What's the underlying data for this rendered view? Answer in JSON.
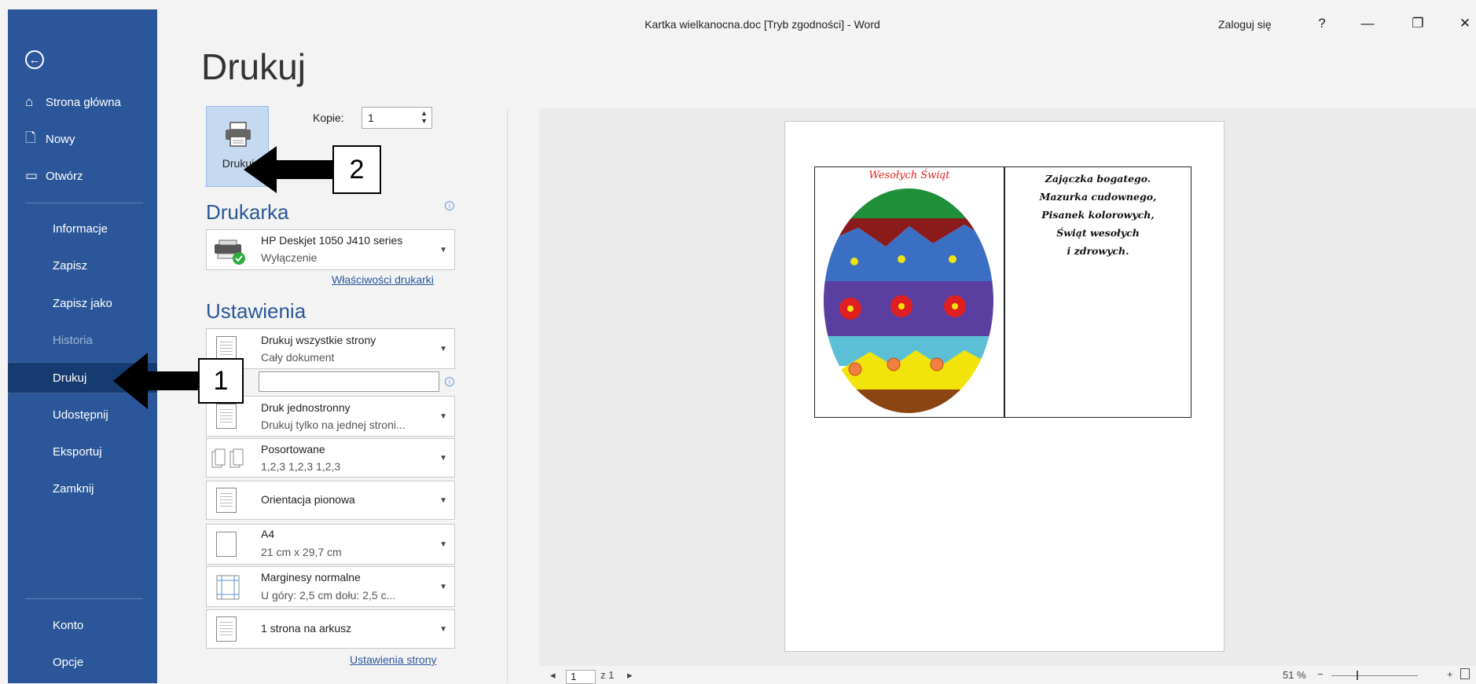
{
  "window": {
    "title": "Kartka wielkanocna.doc [Tryb zgodności]  -  Word",
    "login": "Zaloguj się",
    "help": "?",
    "minimize": "—",
    "restore": "❐",
    "close": "✕"
  },
  "sidebar": {
    "back_icon": "back-arrow-icon",
    "top_items": [
      {
        "label": "Strona główna",
        "icon": "home-icon"
      },
      {
        "label": "Nowy",
        "icon": "new-document-icon"
      },
      {
        "label": "Otwórz",
        "icon": "open-folder-icon"
      }
    ],
    "items": [
      {
        "label": "Informacje"
      },
      {
        "label": "Zapisz"
      },
      {
        "label": "Zapisz jako"
      },
      {
        "label": "Historia"
      },
      {
        "label": "Drukuj"
      },
      {
        "label": "Udostępnij"
      },
      {
        "label": "Eksportuj"
      },
      {
        "label": "Zamknij"
      }
    ],
    "bottom_items": [
      {
        "label": "Konto"
      },
      {
        "label": "Opcje"
      }
    ],
    "active_item": "Drukuj",
    "disabled_item": "Historia",
    "accent_color": "#2b579a"
  },
  "print": {
    "title": "Drukuj",
    "print_button": "Drukuj",
    "copies_label": "Kopie:",
    "copies_value": "1",
    "printer_section": "Drukarka",
    "printer_name": "HP Deskjet 1050 J410 series",
    "printer_status": "Wyłączenie",
    "printer_properties": "Właściwości drukarki",
    "settings_section": "Ustawienia",
    "settings": [
      {
        "line1": "Drukuj wszystkie strony",
        "line2": "Cały dokument"
      },
      {
        "line1": "Druk jednostronny",
        "line2": "Drukuj tylko na jednej stroni..."
      },
      {
        "line1": "Posortowane",
        "line2": "1,2,3   1,2,3   1,2,3"
      },
      {
        "line1": "Orientacja pionowa",
        "line2": ""
      },
      {
        "line1": "A4",
        "line2": "21  cm x 29,7  cm"
      },
      {
        "line1": "Marginesy normalne",
        "line2": "U góry: 2,5  cm dołu: 2,5  c..."
      },
      {
        "line1": "1 strona na arkusz",
        "line2": ""
      }
    ],
    "page_setup_link": "Ustawienia strony"
  },
  "preview": {
    "card_title": "Wesołych Świąt",
    "poem": [
      "Zajączka bogatego.",
      "Mazurka cudownego,",
      "Pisanek kolorowych,",
      "Świąt wesołych",
      "i zdrowych."
    ],
    "current_page": "1",
    "page_total": "z 1",
    "zoom": "51 %"
  },
  "callouts": {
    "one": "1",
    "two": "2"
  }
}
